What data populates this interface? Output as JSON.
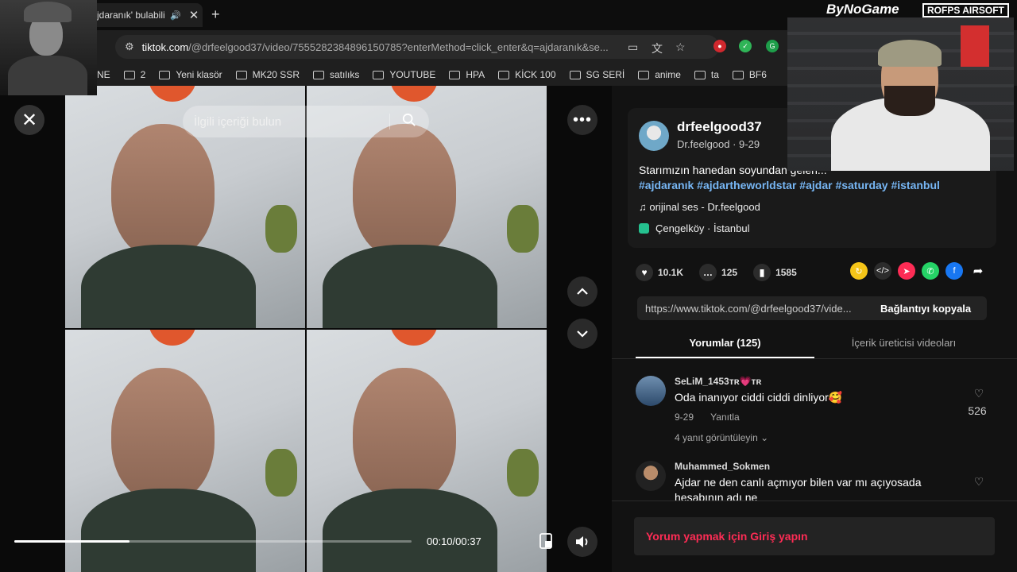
{
  "browser": {
    "tab_title": "jdaranık' bulabili",
    "url_host": "tiktok.com",
    "url_path": "/@drfeelgood37/video/7555282384896150785?enterMethod=click_enter&q=ajdaranık&se...",
    "bookmarks": [
      "NE",
      "2",
      "Yeni klasör",
      "MK20 SSR",
      "satılıks",
      "YOUTUBE",
      "HPA",
      "KİCK 100",
      "SG SERİ",
      "anime",
      "ta",
      "BF6"
    ]
  },
  "video": {
    "search_placeholder": "İlgili içeriği bulun",
    "time": "00:10/00:37",
    "progress": 0.29
  },
  "post": {
    "username": "drfeelgood37",
    "nickname_date": "Dr.feelgood · 9-29",
    "caption": "Starımızın hanedan soyundan gelen...",
    "hashtags": "#ajdaranık #ajdartheworldstar #ajdar #saturday #istanbul",
    "music": "orijinal ses - Dr.feelgood",
    "location": "Çengelköy · İstanbul"
  },
  "stats": {
    "likes": "10.1K",
    "comments": "125",
    "saves": "1585"
  },
  "link": {
    "url": "https://www.tiktok.com/@drfeelgood37/vide...",
    "copy_label": "Bağlantıyı kopyala"
  },
  "tabs": {
    "comments": "Yorumlar (125)",
    "creator_videos": "İçerik üreticisi videoları"
  },
  "comments": [
    {
      "user": "SeLiM_1453ᴛʀ💗ᴛʀ",
      "text": "Oda inanıyor ciddi ciddi dinliyor🥰",
      "date": "9-29",
      "reply": "Yanıtla",
      "replies": "4 yanıt görüntüleyin",
      "likes": "526"
    },
    {
      "user": "Muhammed_Sokmen",
      "text": "Ajdar ne den canlı açmıyor bilen var mı açıyosada",
      "text2": "hesabının adı ne"
    }
  ],
  "login_prompt": "Yorum yapmak için Giriş yapın",
  "overlay": {
    "brand1": "ByNoGame",
    "brand2": "ROFPS AIRSOFT"
  }
}
